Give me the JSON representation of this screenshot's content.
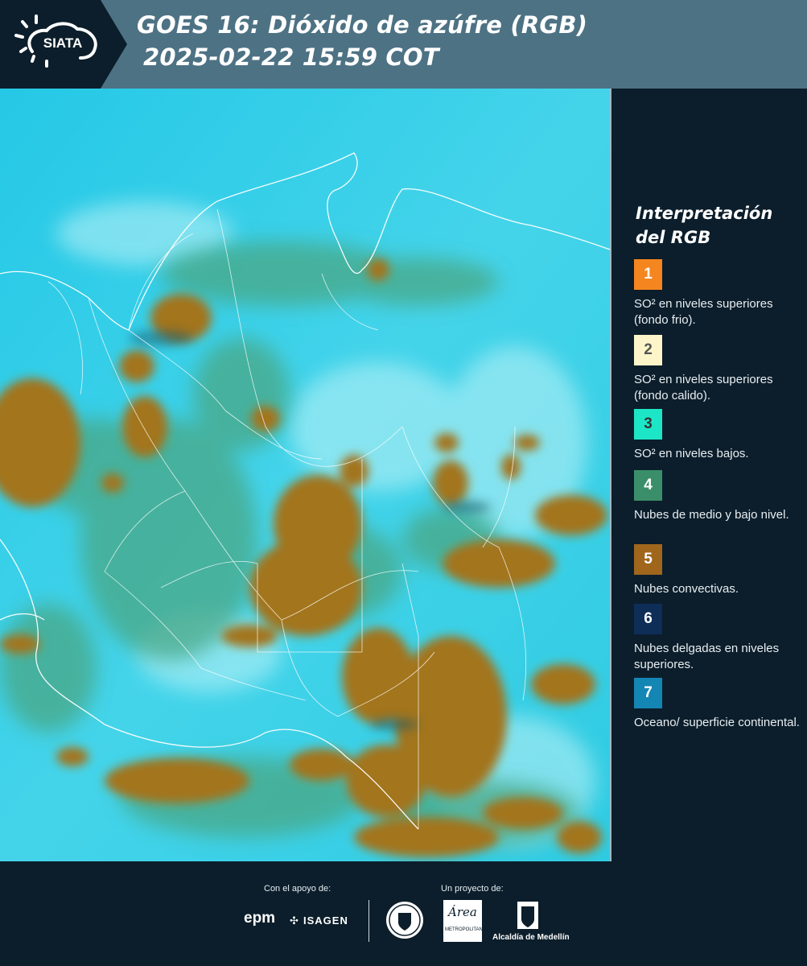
{
  "header": {
    "logo_text": "SIATA",
    "title_line1": "GOES 16: Dióxido de azúfre (RGB)",
    "title_line2": "2025-02-22 15:59 COT"
  },
  "legend": {
    "title": "Interpretación del RGB",
    "items": [
      {
        "number": "1",
        "color": "#f5861f",
        "text": "SO² en niveles superiores (fondo frio)."
      },
      {
        "number": "2",
        "color": "#fdf5c9",
        "text": "SO² en niveles superiores (fondo calido)."
      },
      {
        "number": "3",
        "color": "#1de6c6",
        "text": "SO² en niveles bajos."
      },
      {
        "number": "4",
        "color": "#3a8f6a",
        "text": "Nubes de medio y bajo nivel."
      },
      {
        "number": "5",
        "color": "#a0661c",
        "text": "Nubes convectivas."
      },
      {
        "number": "6",
        "color": "#0e2d57",
        "text": "Nubes delgadas en niveles superiores."
      },
      {
        "number": "7",
        "color": "#1386b4",
        "text": "Oceano/ superficie continental."
      }
    ]
  },
  "footer": {
    "support_label": "Con el apoyo de:",
    "project_label": "Un proyecto de:",
    "epm": "epm",
    "isagen": "ISAGEN",
    "area_top": "Área",
    "area_sub": "METROPOLITANA",
    "alcaldia": "Alcaldía de Medellín"
  }
}
